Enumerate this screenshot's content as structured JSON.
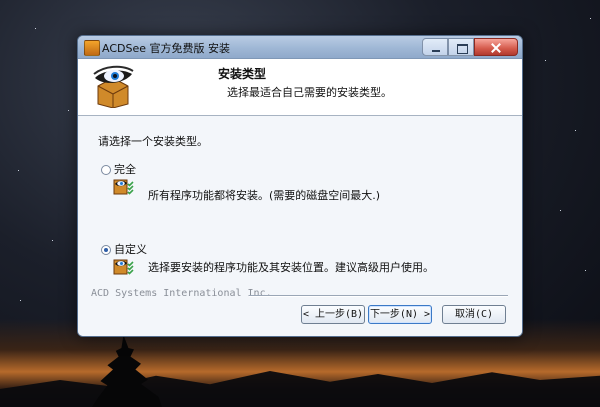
{
  "window": {
    "title": "ACDSee 官方免费版 安装"
  },
  "header": {
    "title": "安装类型",
    "subtitle": "选择最适合自己需要的安装类型。"
  },
  "body": {
    "prompt": "请选择一个安装类型。"
  },
  "options": [
    {
      "label": "完全",
      "description": "所有程序功能都将安装。(需要的磁盘空间最大.)",
      "selected": false,
      "icon": "feature-full-icon"
    },
    {
      "label": "自定义",
      "description": "选择要安装的程序功能及其安装位置。建议高级用户使用。",
      "selected": true,
      "icon": "feature-custom-icon"
    }
  ],
  "footer": {
    "company": "ACD Systems International Inc."
  },
  "buttons": {
    "back": "< 上一步(B)",
    "next": "下一步(N) >",
    "cancel": "取消(C)"
  },
  "colors": {
    "accent": "#2e5ea8",
    "titlebar": "#a9bfdc",
    "header_bg": "#ffffff",
    "client_bg": "#f3f6fa"
  }
}
